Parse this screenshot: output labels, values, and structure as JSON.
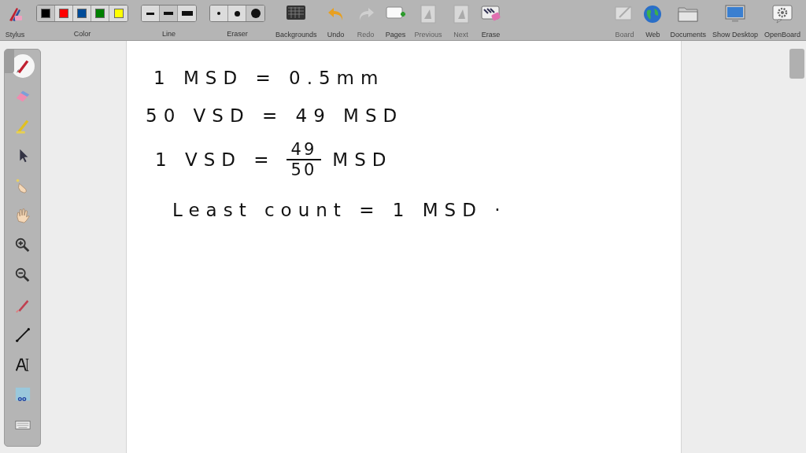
{
  "toolbar": {
    "left": [
      {
        "kind": "button",
        "label": "Stylus",
        "disabled": false
      },
      {
        "kind": "group",
        "label": "Color",
        "options": [
          {
            "color": "#000000",
            "selected": true
          },
          {
            "color": "#ff0000",
            "selected": false
          },
          {
            "color": "#004c99",
            "selected": false
          },
          {
            "color": "#008000",
            "selected": false
          },
          {
            "color": "#ffff00",
            "selected": false
          }
        ]
      },
      {
        "kind": "group",
        "label": "Line",
        "options": [
          {
            "selected": false
          },
          {
            "selected": true
          },
          {
            "selected": false
          }
        ]
      },
      {
        "kind": "group",
        "label": "Eraser",
        "options": [
          {
            "selected": false
          },
          {
            "selected": false
          },
          {
            "selected": true
          }
        ]
      },
      {
        "kind": "button",
        "label": "Backgrounds",
        "disabled": false
      },
      {
        "kind": "button",
        "label": "Undo",
        "disabled": false
      },
      {
        "kind": "button",
        "label": "Redo",
        "disabled": true
      },
      {
        "kind": "button",
        "label": "Pages",
        "disabled": false
      },
      {
        "kind": "button",
        "label": "Previous",
        "disabled": true
      },
      {
        "kind": "button",
        "label": "Next",
        "disabled": true
      },
      {
        "kind": "button",
        "label": "Erase",
        "disabled": false
      }
    ],
    "right": [
      {
        "kind": "button",
        "label": "Board",
        "disabled": true
      },
      {
        "kind": "button",
        "label": "Web",
        "disabled": false
      },
      {
        "kind": "button",
        "label": "Documents",
        "disabled": false
      },
      {
        "kind": "button",
        "label": "Show Desktop",
        "disabled": false
      },
      {
        "kind": "button",
        "label": "OpenBoard",
        "disabled": false
      }
    ]
  },
  "tools": [
    {
      "selected": true
    },
    {
      "selected": false
    },
    {
      "selected": false
    },
    {
      "selected": false
    },
    {
      "selected": false
    },
    {
      "selected": false
    },
    {
      "selected": false
    },
    {
      "selected": false
    },
    {
      "selected": false
    },
    {
      "selected": false
    },
    {
      "selected": false
    },
    {
      "selected": false
    },
    {
      "selected": false
    }
  ],
  "board": {
    "lines": [
      {
        "kind": "text",
        "text": "1 MSD = 0.5mm"
      },
      {
        "kind": "text",
        "text": "50 VSD = 49 MSD"
      },
      {
        "kind": "fraction",
        "before": "1 VSD =",
        "numerator": "49",
        "denominator": "50",
        "after": "MSD"
      },
      {
        "kind": "text",
        "text": "Least count = 1 MSD ·"
      }
    ]
  }
}
